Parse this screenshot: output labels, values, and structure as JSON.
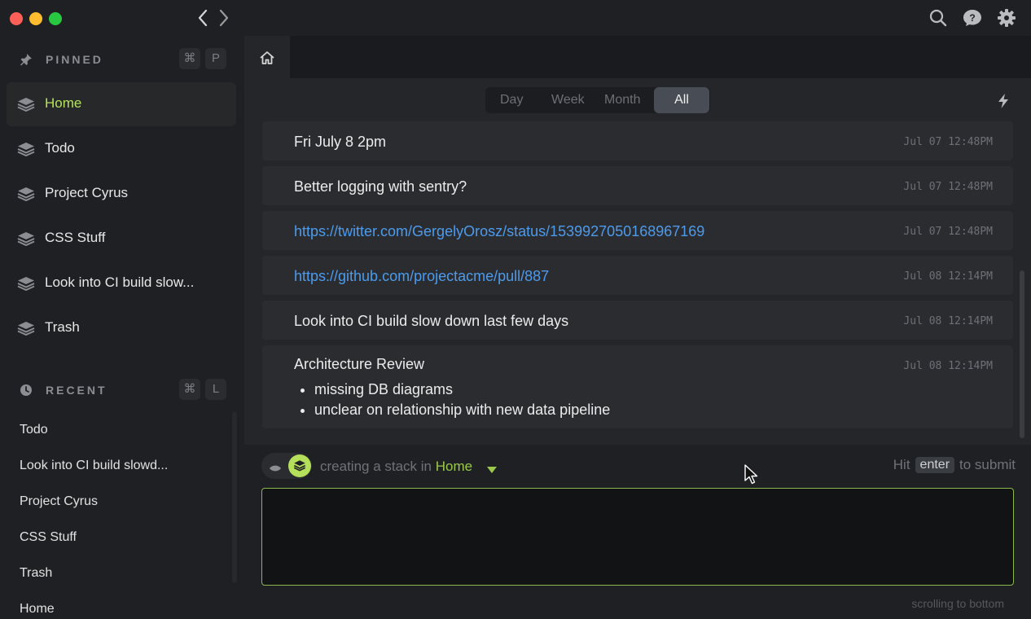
{
  "window": {
    "nav_back_icon": "chevron-left-icon",
    "nav_forward_icon": "chevron-right-icon",
    "toolbar_icons": [
      "search-icon",
      "help-icon",
      "gear-icon"
    ]
  },
  "sidebar": {
    "pinned": {
      "title": "PINNED",
      "shortcut": [
        "⌘",
        "P"
      ],
      "items": [
        {
          "label": "Home",
          "active": true
        },
        {
          "label": "Todo"
        },
        {
          "label": "Project Cyrus"
        },
        {
          "label": "CSS Stuff"
        },
        {
          "label": "Look into CI build slow..."
        },
        {
          "label": "Trash"
        }
      ]
    },
    "recent": {
      "title": "RECENT",
      "shortcut": [
        "⌘",
        "L"
      ],
      "items": [
        {
          "label": "Todo"
        },
        {
          "label": "Look into CI build slowd..."
        },
        {
          "label": "Project Cyrus"
        },
        {
          "label": "CSS Stuff"
        },
        {
          "label": "Trash"
        },
        {
          "label": "Home"
        }
      ]
    }
  },
  "filters": {
    "options": [
      "Day",
      "Week",
      "Month",
      "All"
    ],
    "selected": "All"
  },
  "items": [
    {
      "text": "Fri July 8 2pm",
      "timestamp": "Jul 07 12:48PM"
    },
    {
      "text": "Better logging with sentry?",
      "timestamp": "Jul 07 12:48PM"
    },
    {
      "text": "https://twitter.com/GergelyOrosz/status/1539927050168967169",
      "timestamp": "Jul 07 12:48PM",
      "link": true
    },
    {
      "text": "https://github.com/projectacme/pull/887",
      "timestamp": "Jul 08 12:14PM",
      "link": true
    },
    {
      "text": "Look into CI build slow down last few days",
      "timestamp": "Jul 08 12:14PM"
    },
    {
      "text": "Architecture Review",
      "timestamp": "Jul 08 12:14PM",
      "bullets": [
        "missing DB diagrams",
        "unclear on relationship with new data pipeline"
      ]
    }
  ],
  "composer": {
    "prefix": "creating a stack in ",
    "location": "Home",
    "hint_before": "Hit",
    "hint_key": "enter",
    "hint_after": "to submit",
    "value": "",
    "scroll_note": "scrolling to bottom"
  },
  "colors": {
    "accent": "#b5e15a",
    "link": "#4c9bec",
    "background": "#1f2023"
  }
}
